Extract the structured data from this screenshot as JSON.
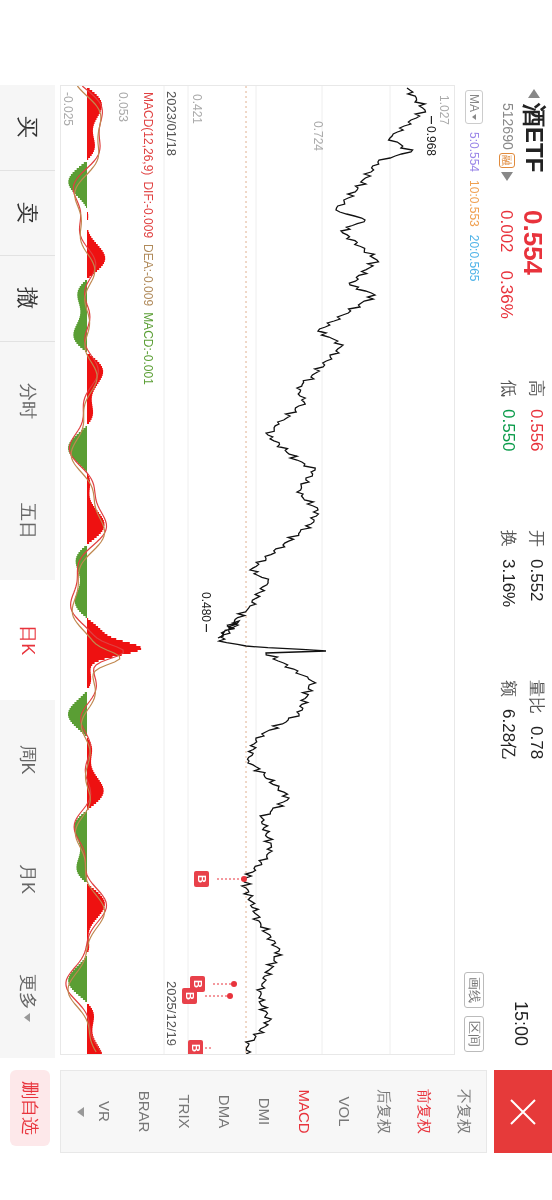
{
  "quote": {
    "name": "酒ETF",
    "code": "512690",
    "badge": "融",
    "price": "0.554",
    "change": "0.002",
    "change_pct": "0.36%",
    "stats": [
      {
        "label": "高",
        "value": "0.556",
        "color": "#e8333c"
      },
      {
        "label": "低",
        "value": "0.550",
        "color": "#0a9b4a"
      },
      {
        "label": "开",
        "value": "0.552",
        "color": "#222222"
      },
      {
        "label": "换",
        "value": "3.16%",
        "color": "#222222"
      },
      {
        "label": "量比",
        "value": "0.78",
        "color": "#222222"
      },
      {
        "label": "额",
        "value": "6.28亿",
        "color": "#222222"
      }
    ]
  },
  "time": "15:00",
  "ma": {
    "label": "MA",
    "values": [
      {
        "text": "5:0.554",
        "color": "#9b87e8"
      },
      {
        "text": "10:0.553",
        "color": "#f0a050"
      },
      {
        "text": "20:0.565",
        "color": "#4fb3e8"
      }
    ]
  },
  "tools": [
    "画线",
    "区间"
  ],
  "chart": {
    "y_labels": [
      "1.027",
      "0.724",
      "0.421"
    ],
    "high_label": "0.968",
    "low_label": "0.480",
    "start_date": "2023/01/18",
    "end_date": "2025/12/19",
    "markers": [
      "B",
      "B",
      "B",
      "B"
    ],
    "macd": {
      "title": "MACD(12,26,9)",
      "dif": "DIF:-0.009",
      "dea": "DEA:-0.009",
      "macd": "MACD:-0.001",
      "top_label": "0.053",
      "bottom_label": "-0.025"
    }
  },
  "trade_tabs": [
    "买",
    "卖",
    "撤"
  ],
  "period_tabs": [
    {
      "label": "分时",
      "selected": false,
      "kind": "tab"
    },
    {
      "label": "五日",
      "selected": false,
      "kind": "tab"
    },
    {
      "label": "日K",
      "selected": true,
      "kind": "tab"
    },
    {
      "label": "周K",
      "selected": false,
      "kind": "tab"
    },
    {
      "label": "月K",
      "selected": false,
      "kind": "tab"
    },
    {
      "label": "更多",
      "selected": false,
      "kind": "dropdown"
    }
  ],
  "adjust_options": [
    {
      "label": "不复权",
      "selected": false
    },
    {
      "label": "前复权",
      "selected": true
    },
    {
      "label": "后复权",
      "selected": false
    }
  ],
  "indicators": [
    {
      "label": "VOL",
      "selected": false
    },
    {
      "label": "MACD",
      "selected": true
    },
    {
      "label": "DMI",
      "selected": false
    },
    {
      "label": "DMA",
      "selected": false
    },
    {
      "label": "TRIX",
      "selected": false
    },
    {
      "label": "BRAR",
      "selected": false
    },
    {
      "label": "VR",
      "selected": false
    }
  ],
  "watchlist_button": "删自选"
}
